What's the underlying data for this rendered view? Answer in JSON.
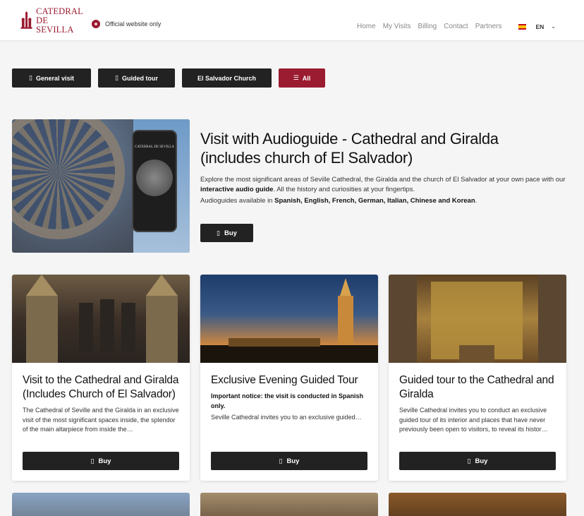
{
  "header": {
    "logo_line1": "CATEDRAL",
    "logo_line2": "DE SEVILLA",
    "official_text": "Official website only",
    "nav": [
      "Home",
      "My Visits",
      "Billing",
      "Contact",
      "Partners"
    ],
    "language": "EN"
  },
  "filters": [
    {
      "label": "General visit",
      "icon": "ticket-icon",
      "active": false
    },
    {
      "label": "Guided tour",
      "icon": "ticket-icon",
      "active": false
    },
    {
      "label": "El Salvador Church",
      "icon": "",
      "active": false
    },
    {
      "label": "All",
      "icon": "list-icon",
      "active": true
    }
  ],
  "featured": {
    "title": "Visit with Audioguide - Cathedral and Giralda (includes church of El Salvador)",
    "desc_part1": "Explore the most significant areas of Seville Cathedral, the Giralda and the church of El Salvador at your own pace with our ",
    "desc_bold": "interactive audio guide",
    "desc_part2": ". All the history and curiosities at your fingertips.",
    "langs_prefix": "Audioguides available in ",
    "langs_bold": "Spanish, English, French, German, Italian, Chinese and Korean",
    "langs_suffix": ".",
    "buy_label": "Buy",
    "phone_text": "CATEDRAL DE SEVILLA"
  },
  "cards": [
    {
      "title": "Visit to the Cathedral and Giralda (Includes Church of El Salvador)",
      "notice": "",
      "body": "The Cathedral of Seville and the Giralda in an exclusive visit of the most significant spaces inside, the splendor of the main altarpiece from inside the…",
      "buy_label": "Buy"
    },
    {
      "title": "Exclusive Evening Guided Tour",
      "notice": "Important notice: the visit is conducted in Spanish only.",
      "body": "Seville Cathedral invites you to an exclusive guided…",
      "buy_label": "Buy"
    },
    {
      "title": "Guided tour to the Cathedral and Giralda",
      "notice": "",
      "body": "Seville Cathedral invites you to conduct an exclusive guided tour of its interior and places that have never previously been open to visitors, to reveal its histor…",
      "buy_label": "Buy"
    }
  ],
  "colors": {
    "brand": "#9b1b30",
    "button": "#222222"
  }
}
